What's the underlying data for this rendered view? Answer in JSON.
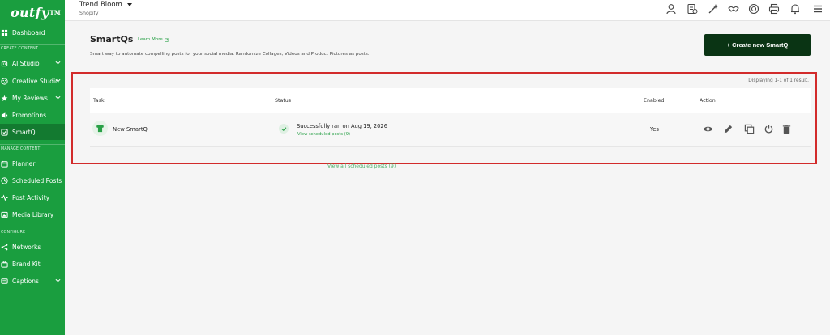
{
  "app": {
    "logo": "outfy",
    "logo_tm": "TM"
  },
  "topbar": {
    "store_name": "Trend Bloom",
    "store_platform": "Shopify",
    "icons": [
      "user-icon",
      "billing-icon",
      "magic-wand-icon",
      "handshake-icon",
      "support-icon",
      "printer-icon",
      "notification-icon",
      "menu-icon"
    ]
  },
  "sidebar": {
    "items": [
      {
        "label": "Dashboard",
        "icon": "dashboard-icon"
      },
      {
        "label": "AI Studio",
        "icon": "robot-icon",
        "has_submenu": true
      },
      {
        "label": "Creative Studio",
        "icon": "palette-icon",
        "has_submenu": true
      },
      {
        "label": "My Reviews",
        "icon": "star-icon",
        "has_submenu": true
      },
      {
        "label": "Promotions",
        "icon": "megaphone-icon"
      },
      {
        "label": "SmartQ",
        "icon": "smartq-icon",
        "active": true
      },
      {
        "label": "Planner",
        "icon": "calendar-icon"
      },
      {
        "label": "Scheduled Posts",
        "icon": "clock-icon"
      },
      {
        "label": "Post Activity",
        "icon": "activity-icon"
      },
      {
        "label": "Media Library",
        "icon": "image-icon"
      },
      {
        "label": "Networks",
        "icon": "network-icon"
      },
      {
        "label": "Brand Kit",
        "icon": "brand-kit-icon"
      },
      {
        "label": "Captions",
        "icon": "caption-icon",
        "has_submenu": true
      }
    ],
    "sections": {
      "create": "CREATE CONTENT",
      "manage": "MANAGE CONTENT",
      "configure": "CONFIGURE"
    }
  },
  "page": {
    "title": "SmartQs",
    "learn_more": "Learn More",
    "description": "Smart way to automate compelling posts for your social media. Randomize Collages, Videos and Product Pictures as posts.",
    "create_button": "+ Create new SmartQ",
    "displaying": "Displaying 1-1 of 1 result.",
    "bottom_link": "View all scheduled posts (9)"
  },
  "table": {
    "columns": {
      "task": "Task",
      "status": "Status",
      "enabled": "Enabled",
      "action": "Action"
    },
    "rows": [
      {
        "task": "New SmartQ",
        "status": "Successfully ran on Aug 19, 2026",
        "status_link": "View scheduled posts (9)",
        "enabled": "Yes",
        "actions": [
          "eye-icon",
          "edit-pencil-icon",
          "copy-icon",
          "power-icon",
          "trash-icon"
        ]
      }
    ]
  },
  "colors": {
    "sidebar_bg": "#1a9e3f",
    "sidebar_active": "#137a30",
    "primary_dark": "#0a3414",
    "link_green": "#2aa148",
    "highlight_red": "#d22b2b"
  }
}
